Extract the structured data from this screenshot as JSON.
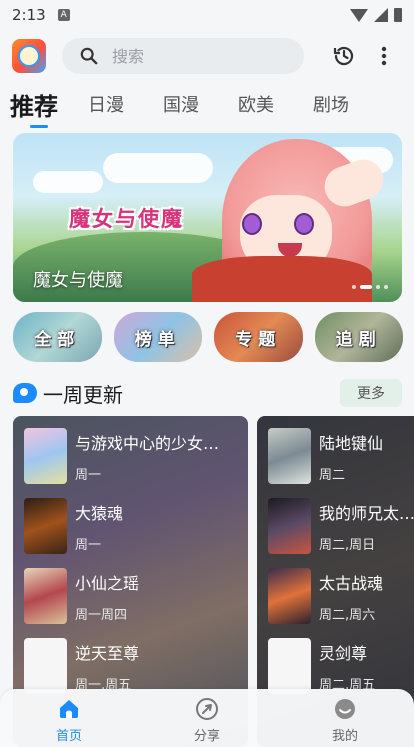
{
  "status_bar": {
    "time": "2:13",
    "sim_letter": "A"
  },
  "search": {
    "placeholder": "搜索"
  },
  "tabs": [
    "推荐",
    "日漫",
    "国漫",
    "欧美",
    "剧场"
  ],
  "banner": {
    "logo_text": "魔女与使魔",
    "caption": "魔女与使魔",
    "page_count": 4,
    "active_index": 1
  },
  "categories": [
    "全部",
    "榜单",
    "专题",
    "追剧"
  ],
  "section": {
    "title": "一周更新",
    "more_label": "更多"
  },
  "weekly_left": [
    {
      "name": "与游戏中心的少女异文化交流的故事",
      "days": "周一"
    },
    {
      "name": "大猿魂",
      "days": "周一"
    },
    {
      "name": "小仙之瑶",
      "days": "周一周四"
    },
    {
      "name": "逆天至尊",
      "days": "周一,周五"
    }
  ],
  "weekly_right": [
    {
      "name": "陆地键仙",
      "days": "周二"
    },
    {
      "name": "我的师兄太强了",
      "days": "周二,周日"
    },
    {
      "name": "太古战魂",
      "days": "周二,周六"
    },
    {
      "name": "灵剑尊",
      "days": "周二,周五"
    }
  ],
  "bottom_nav": [
    {
      "label": "首页",
      "icon": "home-icon",
      "active": true
    },
    {
      "label": "分享",
      "icon": "share-icon",
      "active": false
    },
    {
      "label": "我的",
      "icon": "profile-icon",
      "active": false
    }
  ],
  "colors": {
    "accent": "#1b8cff",
    "more_bg": "#e3efe9"
  }
}
